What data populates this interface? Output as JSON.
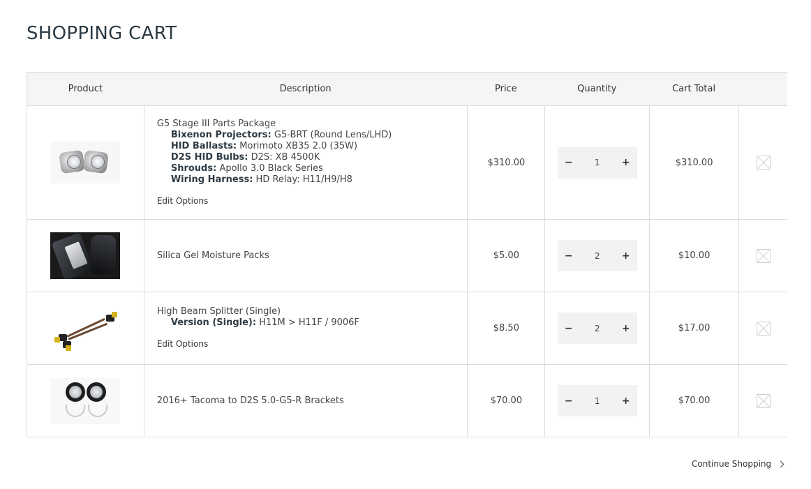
{
  "page": {
    "title": "SHOPPING CART"
  },
  "table": {
    "headers": {
      "product": "Product",
      "description": "Description",
      "price": "Price",
      "quantity": "Quantity",
      "cart_total": "Cart Total"
    }
  },
  "items": [
    {
      "name": "G5 Stage III Parts Package",
      "thumbnail": "bixenon-projectors-image",
      "options": [
        {
          "label": "Bixenon Projectors:",
          "value": "G5-BRT (Round Lens/LHD)"
        },
        {
          "label": "HID Ballasts:",
          "value": "Morimoto XB35 2.0 (35W)"
        },
        {
          "label": "D2S HID Bulbs:",
          "value": "D2S: XB 4500K"
        },
        {
          "label": "Shrouds:",
          "value": "Apollo 3.0 Black Series"
        },
        {
          "label": "Wiring Harness:",
          "value": "HD Relay: H11/H9/H8"
        }
      ],
      "edit_label": "Edit Options",
      "price": "$310.00",
      "quantity": "1",
      "total": "$310.00"
    },
    {
      "name": "Silica Gel Moisture Packs",
      "thumbnail": "silica-gel-image",
      "options": [],
      "price": "$5.00",
      "quantity": "2",
      "total": "$10.00"
    },
    {
      "name": "High Beam Splitter (Single)",
      "thumbnail": "wire-splitter-image",
      "options": [
        {
          "label": "Version (Single):",
          "value": "H11M > H11F / 9006F"
        }
      ],
      "edit_label": "Edit Options",
      "price": "$8.50",
      "quantity": "2",
      "total": "$17.00"
    },
    {
      "name": "2016+ Tacoma to D2S 5.0-G5-R Brackets",
      "thumbnail": "brackets-image",
      "options": [],
      "price": "$70.00",
      "quantity": "1",
      "total": "$70.00"
    }
  ],
  "controls": {
    "minus_symbol": "−",
    "plus_symbol": "+",
    "remove_icon": "close-box-icon"
  },
  "footer": {
    "continue_label": "Continue Shopping",
    "continue_icon": "chevron-right-icon"
  }
}
